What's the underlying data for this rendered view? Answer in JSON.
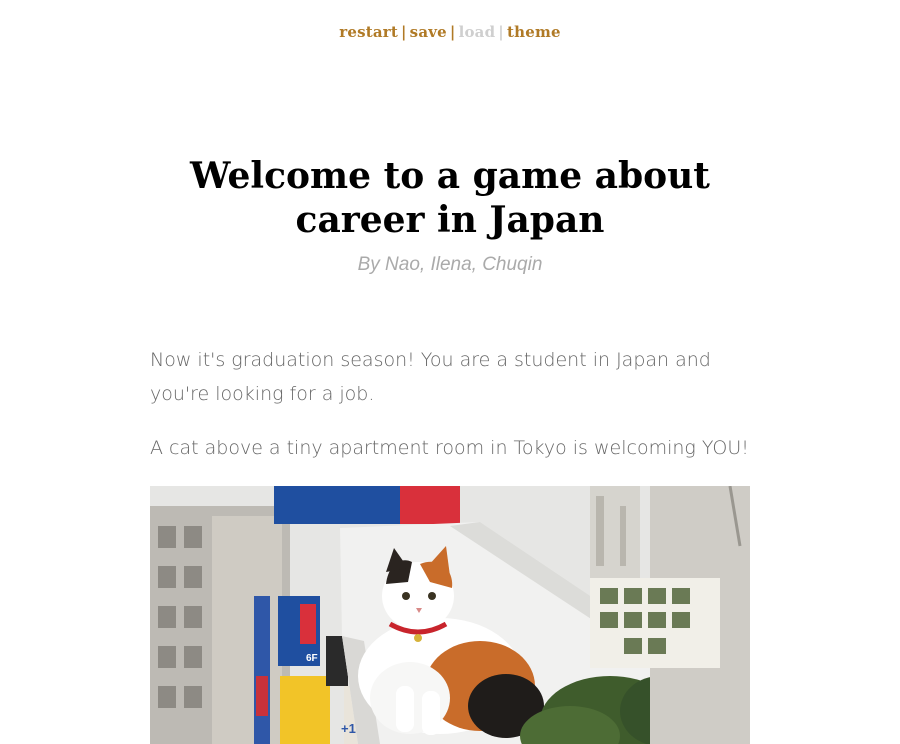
{
  "nav": {
    "restart": "restart",
    "save": "save",
    "load": "load",
    "theme": "theme",
    "separator": "|"
  },
  "header": {
    "title": "Welcome to a game about career in Japan",
    "byline": "By Nao, Ilena, Chuqin"
  },
  "story": {
    "paragraphs": [
      "Now it's graduation season! You are a student in Japan and you're looking for a job.",
      "A cat above a tiny apartment room in Tokyo is welcoming YOU!"
    ]
  },
  "image": {
    "signs": [
      "+1",
      "6F"
    ]
  },
  "colors": {
    "link": "#b07a26",
    "link_disabled": "#cfcfcf",
    "byline": "#aaaaaa",
    "body_text": "#666666"
  }
}
